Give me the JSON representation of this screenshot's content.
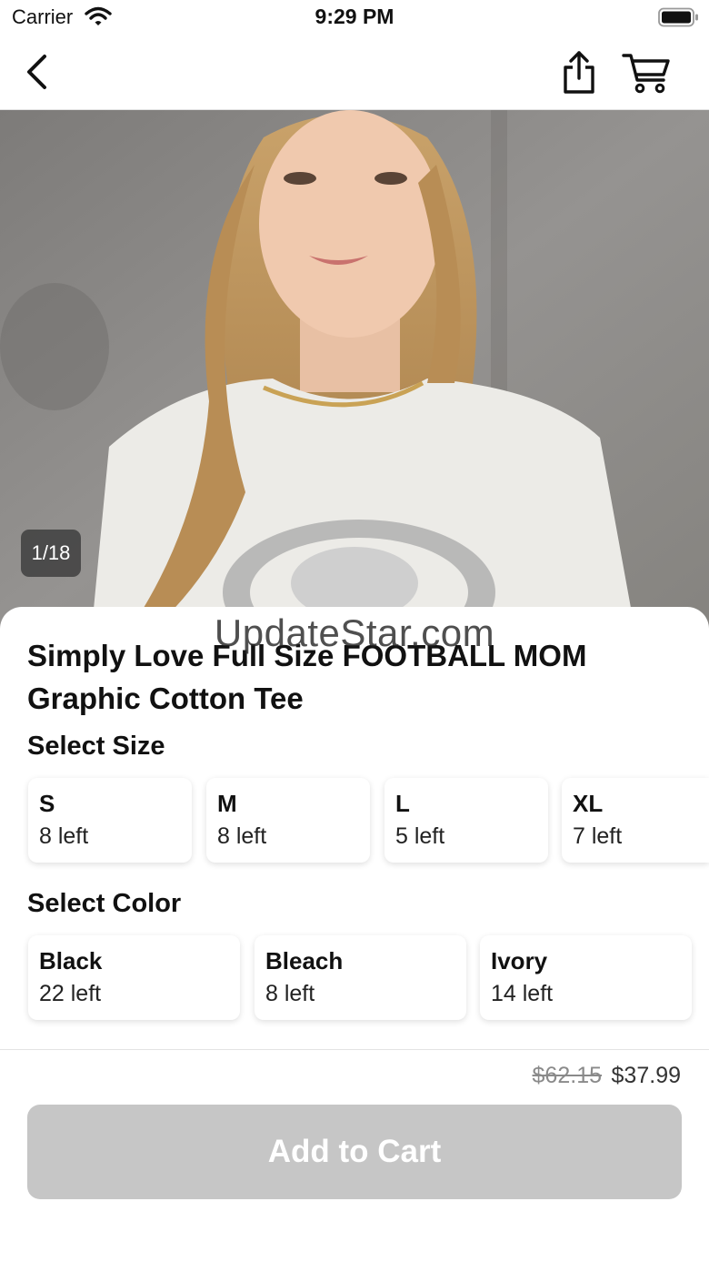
{
  "status_bar": {
    "carrier": "Carrier",
    "time": "9:29 PM"
  },
  "nav": {
    "back_icon": "chevron-left-icon",
    "share_icon": "share-icon",
    "cart_icon": "cart-icon"
  },
  "gallery": {
    "counter": "1/18",
    "current_index": 1,
    "total": 18
  },
  "watermark": "UpdateStar.com",
  "product": {
    "title_line1": "Simply Love Full Size FOOTBALL MOM",
    "title_line2": "Graphic Cotton Tee"
  },
  "size_section": {
    "label": "Select Size",
    "options": [
      {
        "name": "S",
        "stock": "8 left"
      },
      {
        "name": "M",
        "stock": "8 left"
      },
      {
        "name": "L",
        "stock": "5 left"
      },
      {
        "name": "XL",
        "stock": "7 left"
      }
    ]
  },
  "color_section": {
    "label": "Select Color",
    "options": [
      {
        "name": "Black",
        "stock": "22 left"
      },
      {
        "name": "Bleach",
        "stock": "8 left"
      },
      {
        "name": "Ivory",
        "stock": "14 left"
      }
    ]
  },
  "pricing": {
    "original_price": "$62.15",
    "sale_price": "$37.99"
  },
  "add_to_cart": {
    "label": "Add to Cart",
    "enabled": false
  },
  "colors": {
    "button_disabled": "#c6c6c6",
    "counter_badge": "#3c3c3c"
  }
}
